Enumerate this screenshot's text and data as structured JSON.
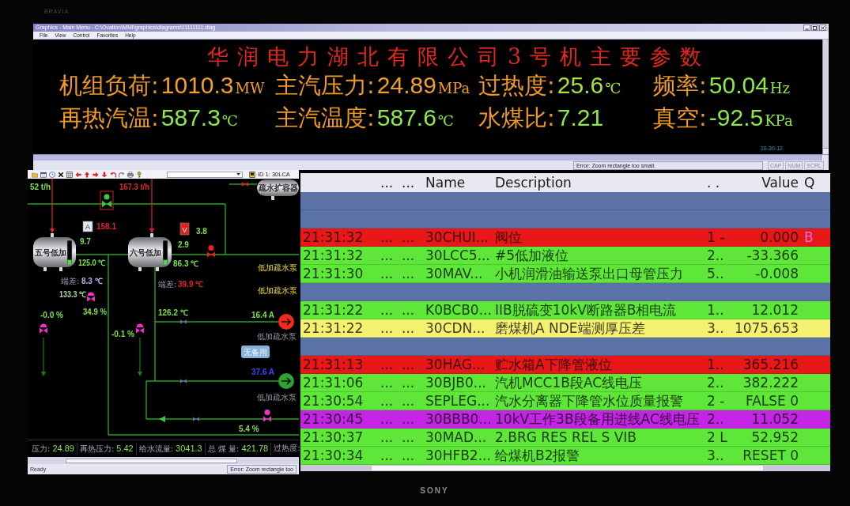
{
  "monitor": {
    "top_brand": "BRAVIA",
    "bottom_brand": "SONY"
  },
  "graphics_window": {
    "title": "Graphics - Main Menu - C:\\Ovation\\MMI\\graphics\\diagrams\\11111111.diag",
    "menu": [
      "File",
      "View",
      "Control",
      "Favorites",
      "Help"
    ],
    "heading": "华润电力湖北有限公司3号机主要参数",
    "metrics": [
      {
        "label": "机组负荷:",
        "value": "1010.3",
        "unit": "MW",
        "color": "#f0a024"
      },
      {
        "label": "主汽压力:",
        "value": "24.89",
        "unit": "MPa",
        "color": "#f0a024"
      },
      {
        "label": "过热度:",
        "value": "25.6",
        "unit": "℃",
        "color": "#a8e040"
      },
      {
        "label": "频率:",
        "value": "50.04",
        "unit": "Hz",
        "color": "#8ee84a"
      },
      {
        "label": "再热汽温:",
        "value": "587.3",
        "unit": "℃",
        "color": "#8ee84a"
      },
      {
        "label": "主汽温度:",
        "value": "587.6",
        "unit": "℃",
        "color": "#8ee84a"
      },
      {
        "label": "水煤比:",
        "value": "7.21",
        "color": "#8ee84a"
      },
      {
        "label": "真空:",
        "value": "-92.5",
        "unit": "KPa",
        "color": "#8ee84a"
      }
    ],
    "clock": "10-30-12",
    "status": "Error: Zoom rectangle too small.",
    "indicators": [
      "CAP",
      "NUM",
      "SCRL"
    ]
  },
  "diagram_window": {
    "id_label": "ID 1: 30LCA",
    "diagram": {
      "vessels": [
        {
          "label": "五号低加",
          "level": 0.18
        },
        {
          "label": "六号低加",
          "level": 0.18
        },
        {
          "label": "疏水扩容器"
        }
      ],
      "valves": [
        {
          "kind": "boxed",
          "color": "#3cc83c"
        },
        {
          "kind": "plain",
          "color": "#e82020"
        },
        {
          "kind": "motor",
          "color": "#e82020"
        },
        {
          "kind": "actuated",
          "color": "#f030c8"
        },
        {
          "kind": "actuated",
          "color": "#f030c8"
        },
        {
          "kind": "actuated",
          "color": "#f030c8"
        },
        {
          "kind": "plain",
          "color": "#6a6a9a"
        },
        {
          "kind": "plain",
          "color": "#6a6a9a"
        },
        {
          "kind": "plain",
          "color": "#6a6a9a"
        },
        {
          "kind": "motor",
          "color": "#f030c8"
        }
      ],
      "tags": [
        {
          "text": "A",
          "color": "#e4e4ee"
        },
        {
          "text": "V",
          "color": "#e02020"
        }
      ],
      "readings": [
        {
          "text": "52 t/h",
          "color": "#7ee04a"
        },
        {
          "text": "167.3 t/h",
          "color": "#e02828"
        },
        {
          "text": "158.1",
          "color": "#e02828"
        },
        {
          "text": "9.7",
          "color": "#7ee04a"
        },
        {
          "text": "3.8",
          "color": "#7ee04a"
        },
        {
          "text": "2.9",
          "color": "#7ee04a"
        },
        {
          "text": "125.0 ℃",
          "color": "#7ee04a"
        },
        {
          "text": "86.3 ℃",
          "color": "#7ee04a"
        },
        {
          "text": "8.3 ℃",
          "color": "#c4a8e8"
        },
        {
          "text": "39.9 ℃",
          "color": "#e02828"
        },
        {
          "text": "133.3 ℃",
          "color": "#a8d8a0"
        },
        {
          "text": "34.9 %",
          "color": "#7ee04a"
        },
        {
          "text": "-0.0 %",
          "color": "#7ee04a"
        },
        {
          "text": "126.2 ℃",
          "color": "#7ee04a"
        },
        {
          "text": "16.4 A",
          "color": "#7ee04a"
        },
        {
          "text": "-0.1 %",
          "color": "#7ee04a"
        },
        {
          "text": "37.6 A",
          "color": "#3848ff"
        },
        {
          "text": "5.4 %",
          "color": "#7ee04a"
        }
      ],
      "notes": [
        "端差:",
        "端差:"
      ],
      "side_labels": [
        "低加疏水泵",
        "低加疏水泵"
      ],
      "pumps": [
        {
          "label": "低加疏水泵",
          "color": "#f02a1e"
        },
        {
          "label": "低加疏水泵",
          "color": "#30a030"
        }
      ],
      "standby": "无备用"
    },
    "summary": [
      {
        "label": "压力:",
        "value": "24.89"
      },
      {
        "label": "再热压力:",
        "value": "5.42"
      },
      {
        "label": "给水流量:",
        "value": "3041.3"
      },
      {
        "label": "总 煤 量:",
        "value": "421.78"
      },
      {
        "label": "过热度:"
      }
    ],
    "status": "Ready",
    "message": "Error: Zoom rectangle too"
  },
  "alarm_list": {
    "columns": [
      "...",
      "...",
      "Name",
      "Description",
      ". .",
      "Value",
      "Q"
    ],
    "rows": [
      {
        "kind": "blank"
      },
      {
        "kind": "blank"
      },
      {
        "kind": "alarm",
        "color": "#e81818",
        "cells": [
          "21:31:32",
          "...",
          "...",
          "30CHUI...",
          "阀位",
          "1 -",
          "0.000",
          "B"
        ]
      },
      {
        "kind": "alarm",
        "color": "#5ee638",
        "cells": [
          "21:31:32",
          "...",
          "...",
          "30LCC5...",
          "#5低加液位",
          "2..",
          "-33.366"
        ]
      },
      {
        "kind": "alarm",
        "color": "#5ee638",
        "cells": [
          "21:31:30",
          "...",
          "...",
          "30MAV...",
          "小机润滑油输送泵出口母管压力",
          "5..",
          "-0.008"
        ]
      },
      {
        "kind": "blank"
      },
      {
        "kind": "alarm",
        "color": "#5ee638",
        "cells": [
          "21:31:22",
          "...",
          "...",
          "K0BCB0...",
          "IIB脱硫变10kV断路器B相电流",
          "1..",
          "12.012"
        ]
      },
      {
        "kind": "alarm",
        "color": "#f4f070",
        "cells": [
          "21:31:22",
          "...",
          "...",
          "30CDN...",
          "磨煤机A NDE端测厚压差",
          "3..",
          "1075.653"
        ]
      },
      {
        "kind": "blank"
      },
      {
        "kind": "alarm",
        "color": "#e81818",
        "cells": [
          "21:31:13",
          "...",
          "...",
          "30HAG...",
          "贮水箱A下降管液位",
          "1..",
          "365.216"
        ]
      },
      {
        "kind": "alarm",
        "color": "#5ee638",
        "cells": [
          "21:31:06",
          "...",
          "...",
          "30BJB0...",
          "汽机MCC1B段AC线电压",
          "2..",
          "382.222"
        ]
      },
      {
        "kind": "alarm",
        "color": "#5ee638",
        "cells": [
          "21:30:54",
          "...",
          "...",
          "SEPLEG...",
          "汽水分离器下降管水位质量报警",
          "2 -",
          "FALSE 0"
        ]
      },
      {
        "kind": "alarm",
        "color": "#c424e4",
        "cells": [
          "21:30:45",
          "...",
          "...",
          "30BBB0...",
          "10kV工作3B段备用进线AC线电压",
          "2..",
          "11.052"
        ]
      },
      {
        "kind": "alarm",
        "color": "#5ee638",
        "cells": [
          "21:30:37",
          "...",
          "...",
          "30MAD...",
          "2.BRG RES REL S VIB",
          "2 L",
          "52.952"
        ]
      },
      {
        "kind": "alarm",
        "color": "#5ee638",
        "cells": [
          "21:30:34",
          "...",
          "...",
          "30HFB2...",
          "给煤机B2报警",
          "3..",
          "RESET 0"
        ]
      }
    ]
  }
}
